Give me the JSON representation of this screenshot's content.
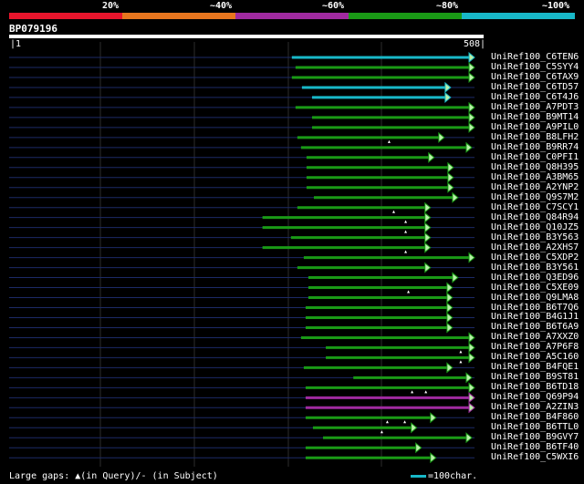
{
  "legend": {
    "labels": [
      "20%",
      "~40%",
      "~60%",
      "~80%",
      "~100%"
    ],
    "colors": [
      "#e8152c",
      "#e8761e",
      "#a02aa0",
      "#1a9a16",
      "#18b8c8"
    ]
  },
  "query": {
    "id": "BP079196",
    "start_label": "|1",
    "end_label": "508|",
    "length": 508
  },
  "hits": [
    {
      "name": "UniRef100_C6TEN6",
      "start": 309,
      "end": 508,
      "color": "#18b8c8",
      "arrow": true,
      "marks": []
    },
    {
      "name": "UniRef100_C5SYY4",
      "start": 313,
      "end": 508,
      "color": "#1a9a16",
      "arrow": true,
      "marks": []
    },
    {
      "name": "UniRef100_C6TAX9",
      "start": 309,
      "end": 508,
      "color": "#1a9a16",
      "arrow": true,
      "marks": []
    },
    {
      "name": "UniRef100_C6TD57",
      "start": 320,
      "end": 482,
      "color": "#18b8c8",
      "arrow": true,
      "marks": []
    },
    {
      "name": "UniRef100_C6T4J6",
      "start": 331,
      "end": 482,
      "color": "#18b8c8",
      "arrow": true,
      "marks": []
    },
    {
      "name": "UniRef100_A7PDT3",
      "start": 313,
      "end": 508,
      "color": "#1a9a16",
      "arrow": true,
      "marks": []
    },
    {
      "name": "UniRef100_B9MT14",
      "start": 331,
      "end": 508,
      "color": "#1a9a16",
      "arrow": true,
      "marks": []
    },
    {
      "name": "UniRef100_A9PIL0",
      "start": 331,
      "end": 508,
      "color": "#1a9a16",
      "arrow": true,
      "marks": []
    },
    {
      "name": "UniRef100_B8LFH2",
      "start": 315,
      "end": 475,
      "color": "#1a9a16",
      "arrow": true,
      "marks": [
        415
      ]
    },
    {
      "name": "UniRef100_B9RR74",
      "start": 319,
      "end": 505,
      "color": "#1a9a16",
      "arrow": true,
      "marks": []
    },
    {
      "name": "UniRef100_C0PFI1",
      "start": 325,
      "end": 464,
      "color": "#1a9a16",
      "arrow": true,
      "marks": []
    },
    {
      "name": "UniRef100_Q8H395",
      "start": 325,
      "end": 485,
      "color": "#1a9a16",
      "arrow": true,
      "marks": []
    },
    {
      "name": "UniRef100_A3BM65",
      "start": 325,
      "end": 485,
      "color": "#1a9a16",
      "arrow": true,
      "marks": []
    },
    {
      "name": "UniRef100_A2YNP2",
      "start": 325,
      "end": 485,
      "color": "#1a9a16",
      "arrow": true,
      "marks": []
    },
    {
      "name": "UniRef100_Q9S7M2",
      "start": 333,
      "end": 490,
      "color": "#1a9a16",
      "arrow": true,
      "marks": []
    },
    {
      "name": "UniRef100_C7SCY1",
      "start": 315,
      "end": 460,
      "color": "#1a9a16",
      "arrow": true,
      "marks": [
        420
      ]
    },
    {
      "name": "UniRef100_Q84R94",
      "start": 277,
      "end": 460,
      "color": "#1a9a16",
      "arrow": true,
      "marks": [
        433
      ]
    },
    {
      "name": "UniRef100_Q10JZ5",
      "start": 277,
      "end": 460,
      "color": "#1a9a16",
      "arrow": true,
      "marks": [
        433
      ]
    },
    {
      "name": "UniRef100_B3Y563",
      "start": 308,
      "end": 460,
      "color": "#1a9a16",
      "arrow": true,
      "marks": []
    },
    {
      "name": "UniRef100_A2XHS7",
      "start": 277,
      "end": 460,
      "color": "#1a9a16",
      "arrow": true,
      "marks": [
        433
      ]
    },
    {
      "name": "UniRef100_C5XDP2",
      "start": 322,
      "end": 508,
      "color": "#1a9a16",
      "arrow": true,
      "marks": []
    },
    {
      "name": "UniRef100_B3Y561",
      "start": 315,
      "end": 460,
      "color": "#1a9a16",
      "arrow": true,
      "marks": []
    },
    {
      "name": "UniRef100_Q3ED96",
      "start": 327,
      "end": 490,
      "color": "#1a9a16",
      "arrow": true,
      "marks": []
    },
    {
      "name": "UniRef100_C5XE09",
      "start": 327,
      "end": 484,
      "color": "#1a9a16",
      "arrow": true,
      "marks": [
        436
      ]
    },
    {
      "name": "UniRef100_Q9LMA8",
      "start": 327,
      "end": 484,
      "color": "#1a9a16",
      "arrow": true,
      "marks": []
    },
    {
      "name": "UniRef100_B6T7Q6",
      "start": 324,
      "end": 484,
      "color": "#1a9a16",
      "arrow": true,
      "marks": []
    },
    {
      "name": "UniRef100_B4G1J1",
      "start": 324,
      "end": 484,
      "color": "#1a9a16",
      "arrow": true,
      "marks": []
    },
    {
      "name": "UniRef100_B6T6A9",
      "start": 324,
      "end": 484,
      "color": "#1a9a16",
      "arrow": true,
      "marks": []
    },
    {
      "name": "UniRef100_A7XXZ0",
      "start": 319,
      "end": 508,
      "color": "#1a9a16",
      "arrow": true,
      "marks": []
    },
    {
      "name": "UniRef100_A7P6F8",
      "start": 346,
      "end": 508,
      "color": "#1a9a16",
      "arrow": true,
      "marks": [
        493
      ]
    },
    {
      "name": "UniRef100_A5C160",
      "start": 346,
      "end": 508,
      "color": "#1a9a16",
      "arrow": true,
      "marks": [
        493
      ]
    },
    {
      "name": "UniRef100_B4FQE1",
      "start": 322,
      "end": 484,
      "color": "#1a9a16",
      "arrow": true,
      "marks": []
    },
    {
      "name": "UniRef100_B9ST81",
      "start": 376,
      "end": 505,
      "color": "#1a9a16",
      "arrow": true,
      "marks": []
    },
    {
      "name": "UniRef100_B6TD18",
      "start": 324,
      "end": 508,
      "color": "#1a9a16",
      "arrow": true,
      "marks": [
        440,
        455
      ]
    },
    {
      "name": "UniRef100_Q69P94",
      "start": 324,
      "end": 508,
      "color": "#a02aa0",
      "arrow": true,
      "marks": []
    },
    {
      "name": "UniRef100_A2ZIN3",
      "start": 324,
      "end": 508,
      "color": "#a02aa0",
      "arrow": true,
      "marks": []
    },
    {
      "name": "UniRef100_B4F860",
      "start": 324,
      "end": 466,
      "color": "#1a9a16",
      "arrow": true,
      "marks": [
        413,
        432
      ]
    },
    {
      "name": "UniRef100_B6TTL0",
      "start": 332,
      "end": 445,
      "color": "#1a9a16",
      "arrow": true,
      "marks": [
        407
      ]
    },
    {
      "name": "UniRef100_B9GVY7",
      "start": 343,
      "end": 505,
      "color": "#1a9a16",
      "arrow": true,
      "marks": []
    },
    {
      "name": "UniRef100_B6TF40",
      "start": 324,
      "end": 450,
      "color": "#1a9a16",
      "arrow": true,
      "marks": []
    },
    {
      "name": "UniRef100_C5WXI6",
      "start": 324,
      "end": 466,
      "color": "#1a9a16",
      "arrow": true,
      "marks": []
    }
  ],
  "footer": {
    "gaps_text": "Large gaps: ▲(in Query)/- (in Subject)",
    "scale_text": "=100char.",
    "scale_color": "#18b8c8"
  }
}
